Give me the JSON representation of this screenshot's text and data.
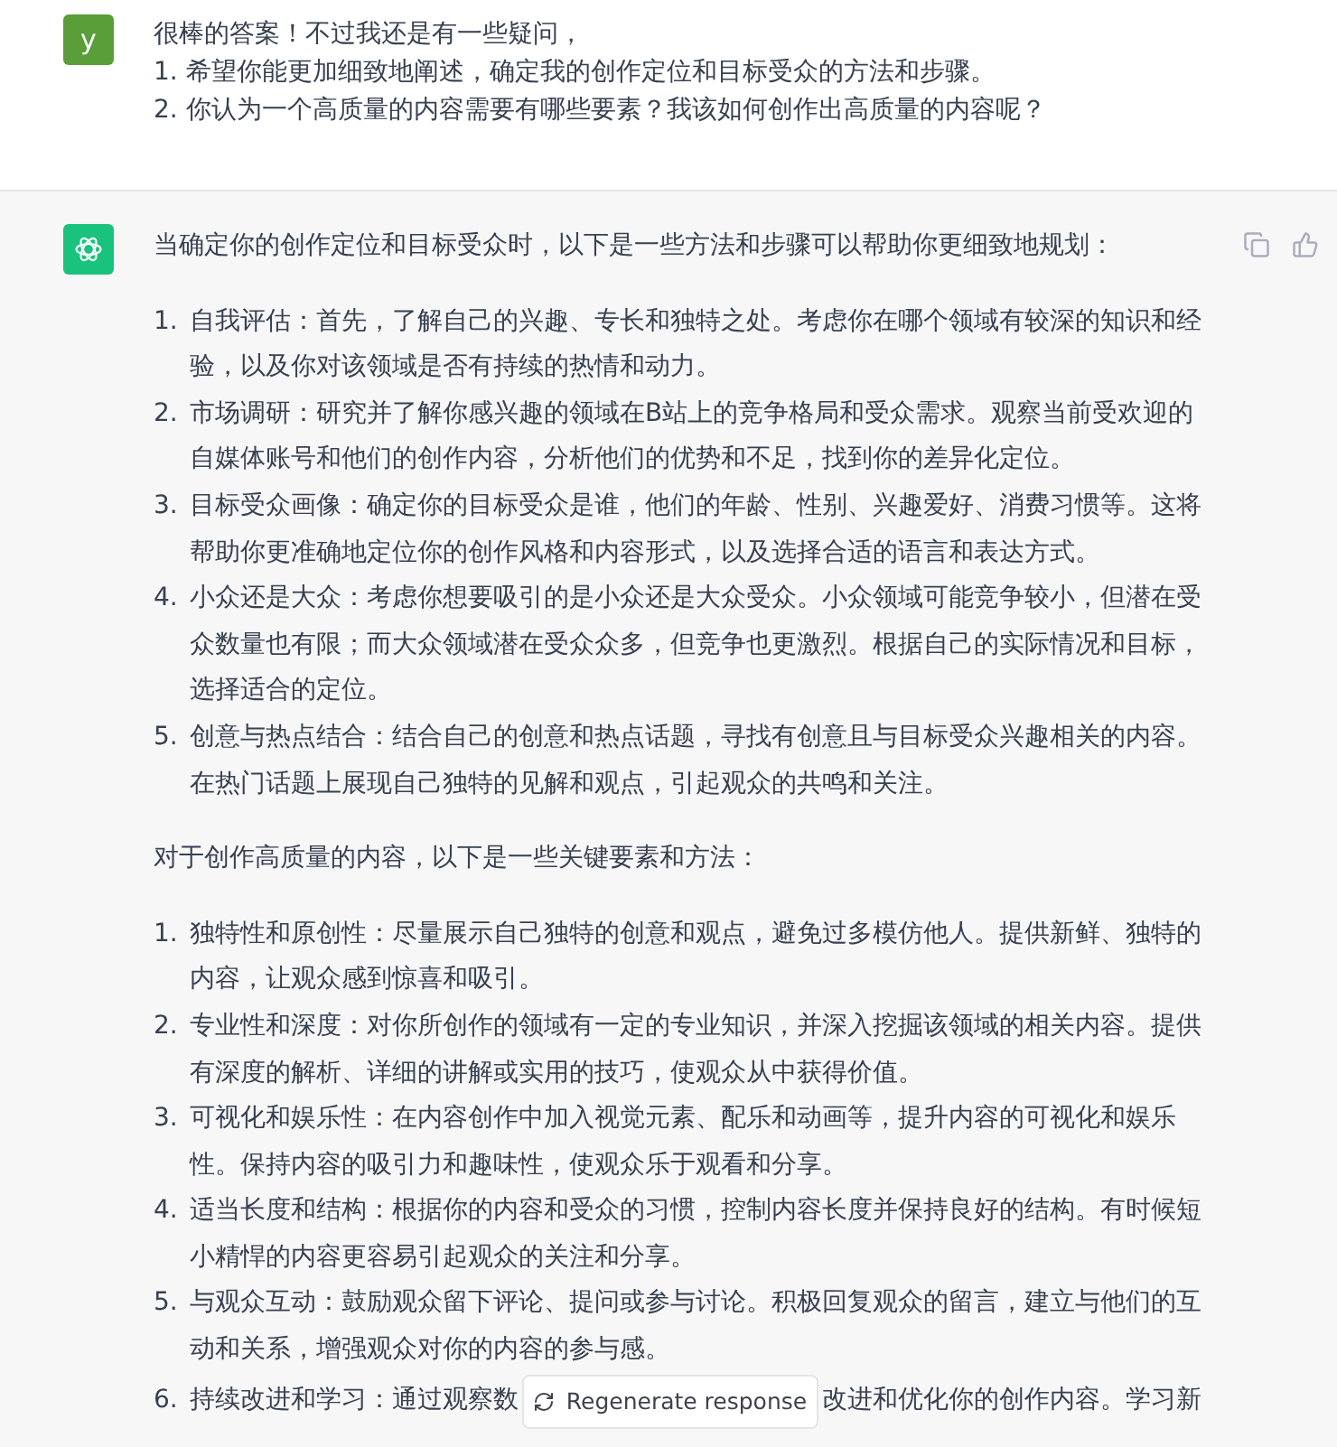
{
  "user_message": {
    "avatar": "y",
    "lines": [
      "很棒的答案！不过我还是有一些疑问，",
      "1. 希望你能更加细致地阐述，确定我的创作定位和目标受众的方法和步骤。",
      "2. 你认为一个高质量的内容需要有哪些要素？我该如何创作出高质量的内容呢？"
    ]
  },
  "assistant_message": {
    "sections": [
      {
        "intro": "当确定你的创作定位和目标受众时，以下是一些方法和步骤可以帮助你更细致地规划：",
        "items": [
          {
            "number": "1.",
            "text": "自我评估：首先，了解自己的兴趣、专长和独特之处。考虑你在哪个领域有较深的知识和经验，以及你对该领域是否有持续的热情和动力。"
          },
          {
            "number": "2.",
            "text": "市场调研：研究并了解你感兴趣的领域在B站上的竞争格局和受众需求。观察当前受欢迎的自媒体账号和他们的创作内容，分析他们的优势和不足，找到你的差异化定位。"
          },
          {
            "number": "3.",
            "text": "目标受众画像：确定你的目标受众是谁，他们的年龄、性别、兴趣爱好、消费习惯等。这将帮助你更准确地定位你的创作风格和内容形式，以及选择合适的语言和表达方式。"
          },
          {
            "number": "4.",
            "text": "小众还是大众：考虑你想要吸引的是小众还是大众受众。小众领域可能竞争较小，但潜在受众数量也有限；而大众领域潜在受众众多，但竞争也更激烈。根据自己的实际情况和目标，选择适合的定位。"
          },
          {
            "number": "5.",
            "text": "创意与热点结合：结合自己的创意和热点话题，寻找有创意且与目标受众兴趣相关的内容。在热门话题上展现自己独特的见解和观点，引起观众的共鸣和关注。"
          }
        ]
      },
      {
        "intro": "对于创作高质量的内容，以下是一些关键要素和方法：",
        "items": [
          {
            "number": "1.",
            "text": "独特性和原创性：尽量展示自己独特的创意和观点，避免过多模仿他人。提供新鲜、独特的内容，让观众感到惊喜和吸引。"
          },
          {
            "number": "2.",
            "text": "专业性和深度：对你所创作的领域有一定的专业知识，并深入挖掘该领域的相关内容。提供有深度的解析、详细的讲解或实用的技巧，使观众从中获得价值。"
          },
          {
            "number": "3.",
            "text": "可视化和娱乐性：在内容创作中加入视觉元素、配乐和动画等，提升内容的可视化和娱乐性。保持内容的吸引力和趣味性，使观众乐于观看和分享。"
          },
          {
            "number": "4.",
            "text": "适当长度和结构：根据你的内容和受众的习惯，控制内容长度并保持良好的结构。有时候短小精悍的内容更容易引起观众的关注和分享。"
          },
          {
            "number": "5.",
            "text": "与观众互动：鼓励观众留下评论、提问或参与讨论。积极回复观众的留言，建立与他们的互动和关系，增强观众对你的内容的参与感。"
          }
        ],
        "partial_item": {
          "number": "6.",
          "text_before": "持续改进和学习：通过观察数",
          "text_after": "改进和优化你的创作内容。学习新"
        }
      }
    ]
  },
  "regenerate_button": {
    "label": "Regenerate response"
  }
}
